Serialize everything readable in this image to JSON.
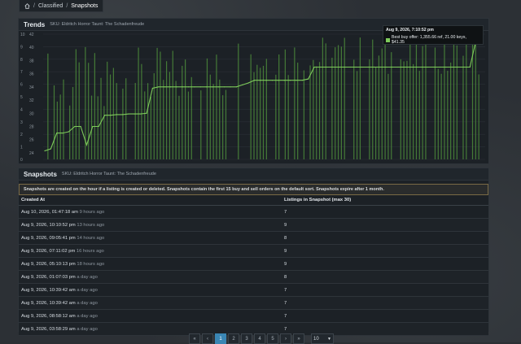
{
  "breadcrumb": {
    "home_icon": "home-icon",
    "items": [
      "Classified",
      "Snapshots"
    ]
  },
  "trends": {
    "title": "Trends",
    "sku": "SKU: Eldritch Horror Taunt: The Schadenfreude",
    "tooltip": {
      "date": "Aug 9, 2026, 7:10:52 pm",
      "text": "Best buy offer: 1,355.66 ref, 21.00 keys, $41.35"
    }
  },
  "chart_data": {
    "type": "line",
    "series": [
      {
        "name": "Best buy offer",
        "color": "#7ecb5b",
        "values": [
          24.3,
          24.6,
          27,
          27,
          27.2,
          28,
          28,
          25.2,
          28,
          28,
          29.7,
          29.7,
          29.8,
          29.8,
          29.9,
          29.9,
          29.9,
          30,
          33.8,
          34,
          34,
          34,
          34,
          34,
          34,
          34,
          34,
          34,
          34,
          34,
          34,
          34,
          34,
          34.3,
          34.6,
          35,
          35,
          35,
          35,
          35,
          35,
          35,
          35,
          35,
          35.2,
          37,
          37,
          37,
          37,
          37,
          37,
          37,
          37,
          37,
          37,
          37,
          37,
          37,
          37,
          37,
          37,
          37,
          37,
          37,
          37,
          37,
          37,
          37,
          37,
          37,
          37,
          37,
          41,
          41
        ]
      }
    ],
    "ylim_right": [
      23,
      42
    ],
    "ylim_left": [
      0,
      10
    ],
    "right_ticks": [
      24,
      26,
      28,
      30,
      32,
      34,
      36,
      38,
      40,
      42
    ],
    "left_ticks": [
      0,
      1,
      2,
      3,
      4,
      5,
      6,
      7,
      8,
      9,
      10
    ],
    "bar_color": "#4c8a3a",
    "bars_right_ticks_note": ""
  },
  "snapshots": {
    "title": "Snapshots",
    "sku": "SKU: Eldritch Horror Taunt: The Schadenfreude",
    "notice": "Snapshots are created on the hour if a listing is created or deleted. Snapshots contain the first 15 buy and sell orders on the default sort. Snapshots expire after 1 month.",
    "col_created": "Created At",
    "col_listings": "Listings in Snapshot (max 30)",
    "rows": [
      {
        "date": "Aug 10, 2026, 01:47:18 am",
        "ago": "9 hours ago",
        "count": "7"
      },
      {
        "date": "Aug 9, 2026, 10:10:52 pm",
        "ago": "13 hours ago",
        "count": "9"
      },
      {
        "date": "Aug 9, 2026, 09:05:41 pm",
        "ago": "14 hours ago",
        "count": "8"
      },
      {
        "date": "Aug 9, 2026, 07:11:02 pm",
        "ago": "16 hours ago",
        "count": "9"
      },
      {
        "date": "Aug 9, 2026, 05:10:13 pm",
        "ago": "18 hours ago",
        "count": "9"
      },
      {
        "date": "Aug 9, 2026, 01:07:03 pm",
        "ago": "a day ago",
        "count": "8"
      },
      {
        "date": "Aug 9, 2026, 10:39:42 am",
        "ago": "a day ago",
        "count": "7"
      },
      {
        "date": "Aug 9, 2026, 10:39:42 am",
        "ago": "a day ago",
        "count": "7"
      },
      {
        "date": "Aug 9, 2026, 08:58:12 am",
        "ago": "a day ago",
        "count": "7"
      },
      {
        "date": "Aug 9, 2026, 03:58:29 am",
        "ago": "a day ago",
        "count": "7"
      }
    ]
  },
  "pager": {
    "first": "«",
    "prev": "‹",
    "pages": [
      "1",
      "2",
      "3",
      "4",
      "5"
    ],
    "next": "›",
    "last": "»",
    "per_page": "10",
    "current": "1"
  }
}
